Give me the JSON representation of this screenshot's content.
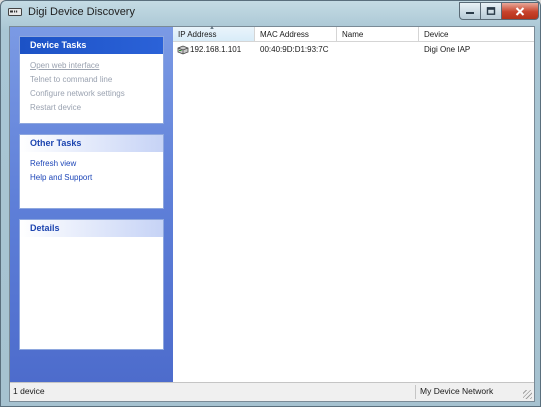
{
  "window": {
    "title": "Digi Device Discovery",
    "controls": {
      "minimize": "minimize-icon",
      "maximize": "maximize-icon",
      "close": "close-icon"
    }
  },
  "sidebar": {
    "device_tasks": {
      "title": "Device Tasks",
      "items": [
        {
          "label": "Open web interface",
          "enabled": false
        },
        {
          "label": "Telnet to command line",
          "enabled": false
        },
        {
          "label": "Configure network settings",
          "enabled": false
        },
        {
          "label": "Restart device",
          "enabled": false
        }
      ]
    },
    "other_tasks": {
      "title": "Other Tasks",
      "items": [
        {
          "label": "Refresh view",
          "enabled": true
        },
        {
          "label": "Help and Support",
          "enabled": true
        }
      ]
    },
    "details": {
      "title": "Details"
    }
  },
  "list": {
    "columns": [
      "IP Address",
      "MAC Address",
      "Name",
      "Device"
    ],
    "sorted_column": "IP Address",
    "rows": [
      {
        "ip": "192.168.1.101",
        "mac": "00:40:9D:D1:93:7C",
        "name": "",
        "device": "Digi One IAP"
      }
    ]
  },
  "status": {
    "count": "1 device",
    "network": "My Device Network"
  },
  "colors": {
    "task_header": "#1c52c6",
    "sidebar": "#5e7fd8",
    "link": "#1d46b8",
    "close_button": "#c8432b"
  }
}
